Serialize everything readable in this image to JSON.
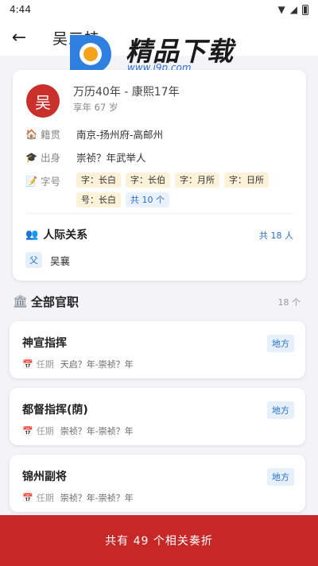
{
  "status_bar": {
    "time": "4:44"
  },
  "app_bar": {
    "title": "吴三桂"
  },
  "watermark": {
    "text": "精品下载",
    "url": "www.j9p.com"
  },
  "profile": {
    "avatar_char": "吴",
    "lifespan": "万历40年 - 康熙17年",
    "age": "享年 67 岁",
    "native_label": "籍贯",
    "native_value": "南京-扬州府-高邮州",
    "origin_label": "出身",
    "origin_value": "崇祯？年武举人",
    "names_label": "字号",
    "names": [
      "字：长白",
      "字：长伯",
      "字：月所",
      "字：日所",
      "号：长白"
    ],
    "names_more": "共 10 个",
    "relations_title": "人际关系",
    "relations_count": "共 18 人",
    "relations": [
      {
        "badge": "父",
        "name": "吴襄"
      }
    ]
  },
  "offices": {
    "title": "全部官职",
    "count": "18 个",
    "term_label": "任期",
    "items": [
      {
        "name": "神宣指挥",
        "type": "地方",
        "term": "天启？年-崇祯？年"
      },
      {
        "name": "都督指挥(荫)",
        "type": "地方",
        "term": "崇祯？年-崇祯？年"
      },
      {
        "name": "锦州副将",
        "type": "地方",
        "term": "崇祯？年-崇祯？年"
      }
    ]
  },
  "bottom_button": {
    "label": "共有 49 个相关奏折"
  },
  "colors": {
    "accent": "#c62828",
    "link": "#2a6fc9"
  }
}
